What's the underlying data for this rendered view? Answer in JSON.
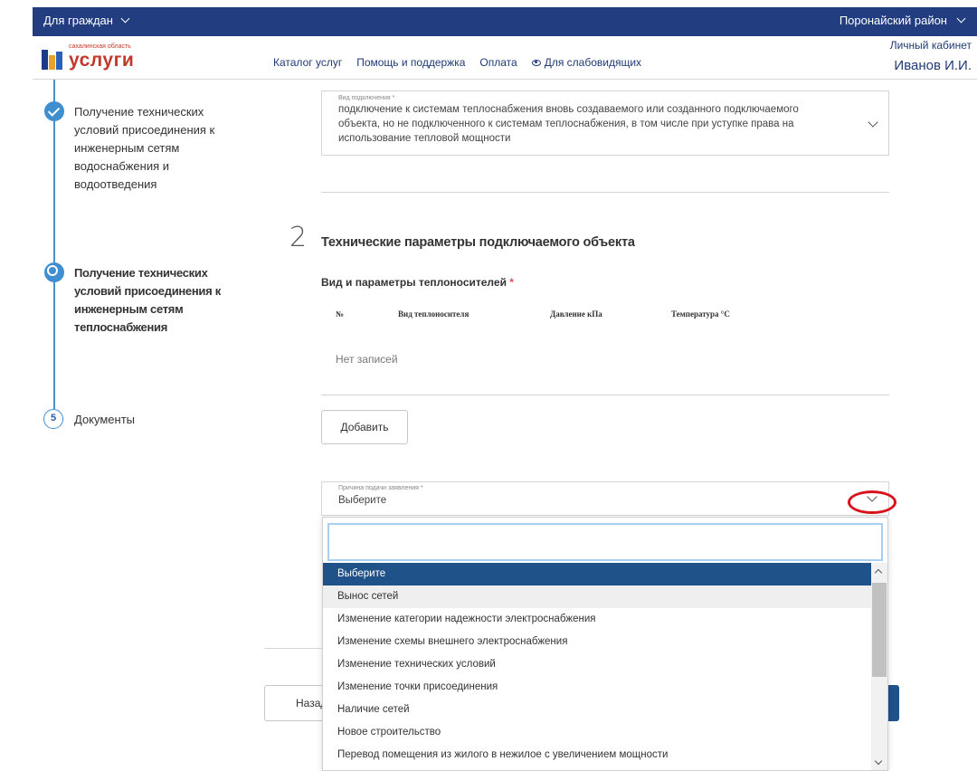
{
  "topbar": {
    "citizens_menu": "Для граждан",
    "region": "Поронайский район"
  },
  "header": {
    "logo_small": "сахалинская область",
    "logo_text": "услуги",
    "nav": [
      "Каталог услуг",
      "Помощь и поддержка",
      "Оплата",
      "Для слабовидящих"
    ],
    "account_label": "Личный кабинет",
    "user_name": "Иванов И.И."
  },
  "stepper": {
    "step1": [
      "Получение технических",
      "условий присоединения к",
      "инженерным сетям",
      "водоснабжения и",
      "водоотведения"
    ],
    "step2": [
      "Получение технических",
      "условий присоединения к",
      "инженерным сетям",
      "теплоснабжения"
    ],
    "step3_number": "5",
    "step3": "Документы"
  },
  "connection_type": {
    "label": "Вид подключения *",
    "value": [
      "подключение к системам теплоснабжения вновь создаваемого или созданного подключаемого",
      "объекта, но не подключенного к системам теплоснабжения, в том числе при уступке права на",
      "использование тепловой мощности"
    ]
  },
  "section2": {
    "number": "2",
    "title": "Технические параметры подключаемого объекта",
    "subtitle": "Вид и параметры теплоносителей",
    "required_mark": "*",
    "table_headers": [
      "№",
      "Вид теплоносителя",
      "Давление кПа",
      "Температура °С"
    ],
    "empty_text": "Нет записей",
    "add_button": "Добавить"
  },
  "reason": {
    "label": "Причина подачи заявления *",
    "value": "Выберите"
  },
  "dropdown": {
    "options": [
      "Выберите",
      "Вынос сетей",
      "Изменение категории надежности электроснабжения",
      "Изменение схемы внешнего электроснабжения",
      "Изменение технических условий",
      "Изменение точки присоединения",
      "Наличие сетей",
      "Новое строительство",
      "Перевод помещения из жилого в нежилое с увеличением мощности"
    ],
    "selected_index": 0,
    "hover_index": 1
  },
  "footer": {
    "back_button_partial": "Назад"
  },
  "colors": {
    "topbar": "#233e80",
    "accent": "#3f8ed0",
    "selected": "#20528a",
    "logo_red": "#c0392b",
    "highlight_ellipse": "#d9131c"
  }
}
